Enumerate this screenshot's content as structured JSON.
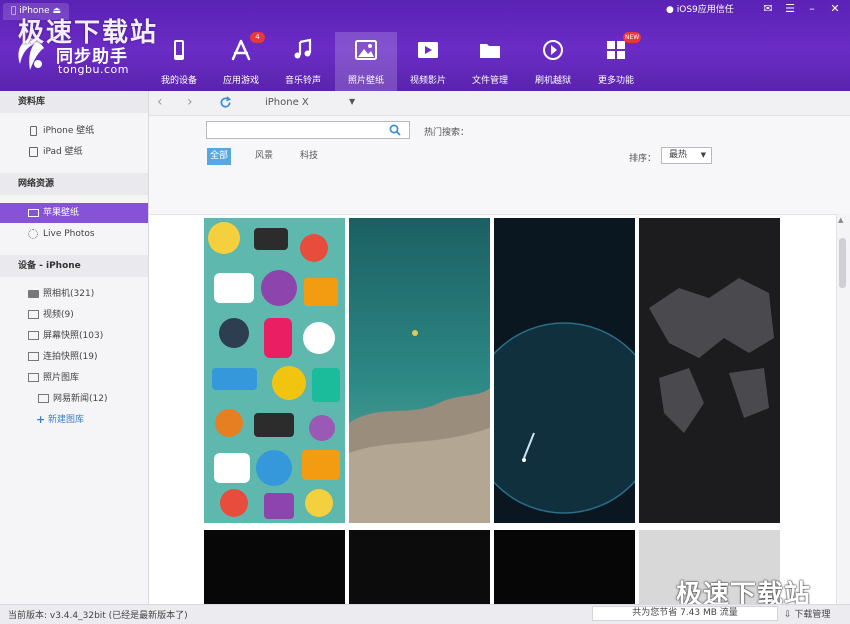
{
  "header": {
    "device_tab": "iPhone",
    "brand_cn": "同步助手",
    "brand_en": "tongbu.com",
    "watermark": "极速下载站",
    "ios_trust": "iOS9应用信任",
    "nav": [
      {
        "label": "我的设备",
        "icon": "phone-icon"
      },
      {
        "label": "应用游戏",
        "icon": "app-store-icon",
        "badge": "4"
      },
      {
        "label": "音乐铃声",
        "icon": "music-note-icon"
      },
      {
        "label": "照片壁纸",
        "icon": "picture-icon"
      },
      {
        "label": "视频影片",
        "icon": "video-icon"
      },
      {
        "label": "文件管理",
        "icon": "folder-icon"
      },
      {
        "label": "刷机越狱",
        "icon": "jailbreak-icon"
      },
      {
        "label": "更多功能",
        "icon": "grid-icon",
        "badge": "NEW"
      }
    ],
    "active_nav": "照片壁纸"
  },
  "sidebar": {
    "library_title": "资料库",
    "library_items": [
      {
        "label": "iPhone 壁纸",
        "icon": "phone-outline-icon"
      },
      {
        "label": "iPad 壁纸",
        "icon": "tablet-outline-icon"
      }
    ],
    "network_title": "网络资源",
    "network_items": [
      {
        "label": "苹果壁纸",
        "icon": "wallpaper-icon"
      },
      {
        "label": "Live Photos",
        "icon": "live-photos-icon"
      }
    ],
    "device_title": "设备 - iPhone",
    "device_items": [
      {
        "label": "照相机(321)",
        "icon": "camera-icon"
      },
      {
        "label": "视频(9)",
        "icon": "video-small-icon"
      },
      {
        "label": "屏幕快照(103)",
        "icon": "album-icon"
      },
      {
        "label": "连拍快照(19)",
        "icon": "album-icon"
      },
      {
        "label": "照片图库",
        "icon": "album-icon"
      }
    ],
    "sub_items": [
      {
        "label": "网易新闻(12)",
        "icon": "album-icon"
      }
    ],
    "new_album": "新建图库"
  },
  "toolbar": {
    "model": "iPhone X"
  },
  "search": {
    "value": "",
    "placeholder": "",
    "hot_label": "热门搜索："
  },
  "categories": [
    "全部",
    "风景",
    "科技"
  ],
  "sort": {
    "label": "排序：",
    "value": "最热"
  },
  "colors": {
    "header": "#6a2cc5",
    "active_sidebar": "#8653d8",
    "active_category": "#5aa6df"
  },
  "statusbar": {
    "version": "当前版本: v3.4.4_32bit  (已经是最新版本了)",
    "saved": "共为您节省  7.43 MB 流量",
    "download": "下载管理"
  }
}
